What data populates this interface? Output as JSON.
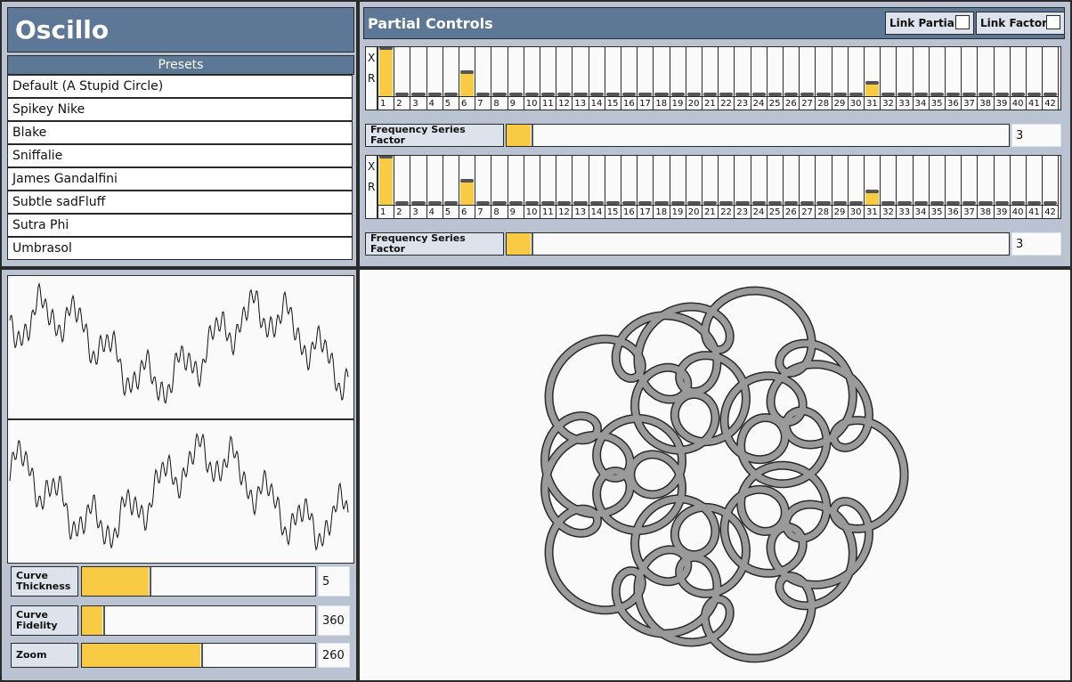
{
  "app": {
    "title": "Oscillo"
  },
  "presets": {
    "header": "Presets",
    "items": [
      "Default (A Stupid Circle)",
      "Spikey Nike",
      "Blake",
      "Sniffalie",
      "James Gandalfini",
      "Subtle sadFluff",
      "Sutra Phi",
      "Umbrasol"
    ]
  },
  "partials": {
    "title": "Partial Controls",
    "link_partials_label": "Link Partials",
    "link_factors_label": "Link Factors",
    "link_partials_checked": false,
    "link_factors_checked": false,
    "row_labels": [
      "X",
      "R"
    ],
    "x": {
      "indices": [
        "1",
        "2",
        "3",
        "4",
        "5",
        "6",
        "7",
        "8",
        "9",
        "10",
        "11",
        "12",
        "13",
        "14",
        "15",
        "16",
        "17",
        "18",
        "19",
        "20",
        "21",
        "22",
        "23",
        "24",
        "25",
        "26",
        "27",
        "28",
        "29",
        "30",
        "31",
        "32",
        "33",
        "34",
        "35",
        "36",
        "37",
        "38",
        "39",
        "40",
        "41",
        "42"
      ],
      "levels": [
        1.0,
        0,
        0,
        0,
        0,
        0.5,
        0,
        0,
        0,
        0,
        0,
        0,
        0,
        0,
        0,
        0,
        0,
        0,
        0,
        0,
        0,
        0,
        0,
        0,
        0,
        0,
        0,
        0,
        0,
        0,
        0.28,
        0,
        0,
        0,
        0,
        0,
        0,
        0,
        0,
        0,
        0,
        0
      ],
      "factor_label": "Frequency Series Factor",
      "factor_value": "3",
      "factor_fraction": 0.05
    },
    "r": {
      "indices": [
        "1",
        "2",
        "3",
        "4",
        "5",
        "6",
        "7",
        "8",
        "9",
        "10",
        "11",
        "12",
        "13",
        "14",
        "15",
        "16",
        "17",
        "18",
        "19",
        "20",
        "21",
        "22",
        "23",
        "24",
        "25",
        "26",
        "27",
        "28",
        "29",
        "30",
        "31",
        "32",
        "33",
        "34",
        "35",
        "36",
        "37",
        "38",
        "39",
        "40",
        "41",
        "42"
      ],
      "levels": [
        1.0,
        0,
        0,
        0,
        0,
        0.5,
        0,
        0,
        0,
        0,
        0,
        0,
        0,
        0,
        0,
        0,
        0,
        0,
        0,
        0,
        0,
        0,
        0,
        0,
        0,
        0,
        0,
        0,
        0,
        0,
        0.28,
        0,
        0,
        0,
        0,
        0,
        0,
        0,
        0,
        0,
        0,
        0
      ],
      "factor_label": "Frequency Series Factor",
      "factor_value": "3",
      "factor_fraction": 0.05
    }
  },
  "controls": {
    "thickness": {
      "label": "Curve Thickness",
      "value": "5",
      "fraction": 0.29
    },
    "fidelity": {
      "label": "Curve Fidelity",
      "value": "360",
      "fraction": 0.09
    },
    "zoom": {
      "label": "Zoom",
      "value": "260",
      "fraction": 0.51
    }
  },
  "colors": {
    "accent": "#f9cb45",
    "header": "#5d7797",
    "panel": "#b9c3d1",
    "curve": "#8a8a8a"
  }
}
